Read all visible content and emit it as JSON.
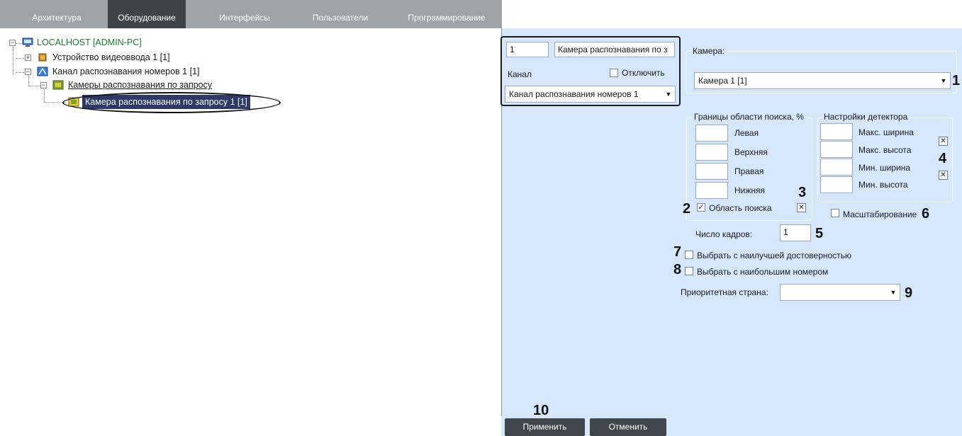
{
  "tabs": [
    {
      "label": "Архитектура",
      "active": false
    },
    {
      "label": "Оборудование",
      "active": true
    },
    {
      "label": "Интерфейсы",
      "active": false
    },
    {
      "label": "Пользователи",
      "active": false
    },
    {
      "label": "Программирование",
      "active": false
    }
  ],
  "tree": {
    "root": "LOCALHOST [ADMIN-PC]",
    "video_input": "Устройство видеоввода 1 [1]",
    "lpr_channel": "Канал распознавания номеров 1 [1]",
    "cameras_folder": "Камеры распознавания по запросу",
    "selected_camera": "Камера распознавания по запросу 1 [1]"
  },
  "object": {
    "id": "1",
    "name": "Камера распознавания по з",
    "channel_label": "Канал",
    "disable_label": "Отключить",
    "channel_value": "Канал распознавания номеров 1"
  },
  "camera": {
    "group_label": "Камера:",
    "value": "Камера 1 [1]"
  },
  "search_bounds": {
    "title": "Границы области поиска, %",
    "left": "Левая",
    "top": "Верхняя",
    "right": "Правая",
    "bottom": "Нижняя",
    "search_area_label": "Область поиска",
    "search_area_checked": true
  },
  "detector": {
    "title": "Настройки детектора",
    "max_width": "Макс. ширина",
    "max_height": "Макс. высота",
    "min_width": "Мин. ширина",
    "min_height": "Мин. высота"
  },
  "scaling_label": "Масштабирование",
  "frames": {
    "label": "Число кадров:",
    "value": "1"
  },
  "best_confidence_label": "Выбрать с наилучшей достоверностью",
  "largest_number_label": "Выбрать с наибольшим номером",
  "priority_country": {
    "label": "Приоритетная страна:",
    "value": ""
  },
  "buttons": {
    "apply": "Применить",
    "cancel": "Отменить"
  },
  "callouts": {
    "n1": "1",
    "n2": "2",
    "n3": "3",
    "n4": "4",
    "n5": "5",
    "n6": "6",
    "n7": "7",
    "n8": "8",
    "n9": "9",
    "n10": "10"
  },
  "icons": {
    "check": "✓",
    "clear": "✕",
    "dropdown": "▼",
    "expand_minus": "−",
    "expand_plus": "+"
  },
  "colors": {
    "tabbar": "#9ea3a7",
    "active_tab": "#3f4448",
    "panel": "#d6e6fb",
    "selection": "#2d3a67",
    "root_text": "#1c7a32",
    "button": "#40464c"
  }
}
